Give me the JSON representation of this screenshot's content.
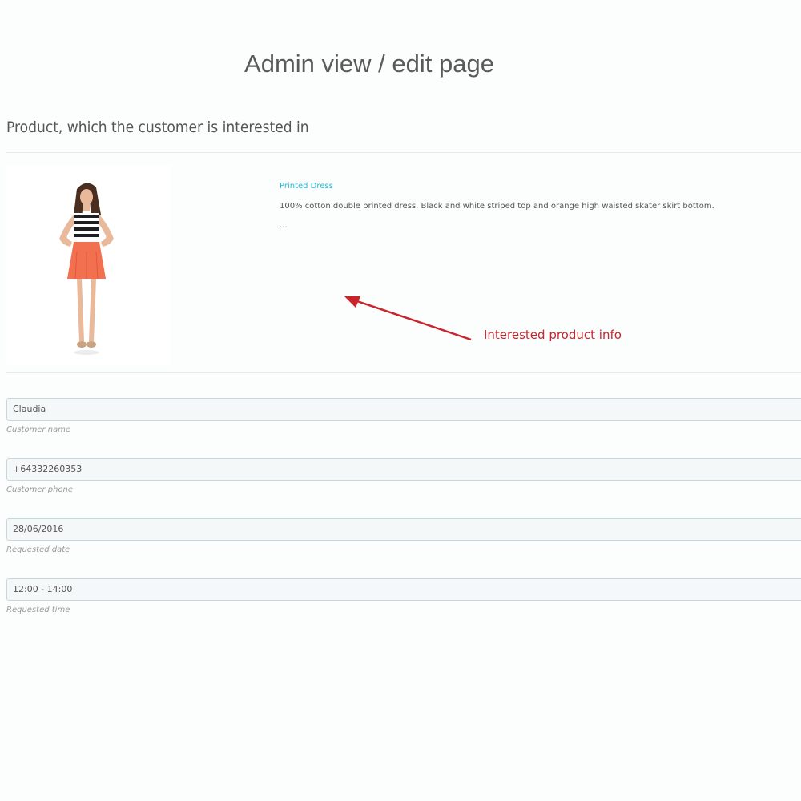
{
  "page_title": "Admin view / edit page",
  "section_heading": "Product, which the customer is interested in",
  "product": {
    "name": "Printed Dress",
    "description": "100% cotton double printed dress. Black and white striped top and orange high waisted skater skirt bottom.",
    "more": "...",
    "image_icon": "model-photo",
    "colors": {
      "link": "#25b9d7",
      "skirt": "#f26f4f"
    }
  },
  "annotation": {
    "text": "Interested product info",
    "color": "#c8242c",
    "icon": "arrow-icon"
  },
  "fields": [
    {
      "value": "Claudia",
      "help": "Customer name"
    },
    {
      "value": "+64332260353",
      "help": "Customer phone"
    },
    {
      "value": "28/06/2016",
      "help": "Requested date"
    },
    {
      "value": "12:00 - 14:00",
      "help": "Requested time"
    }
  ]
}
